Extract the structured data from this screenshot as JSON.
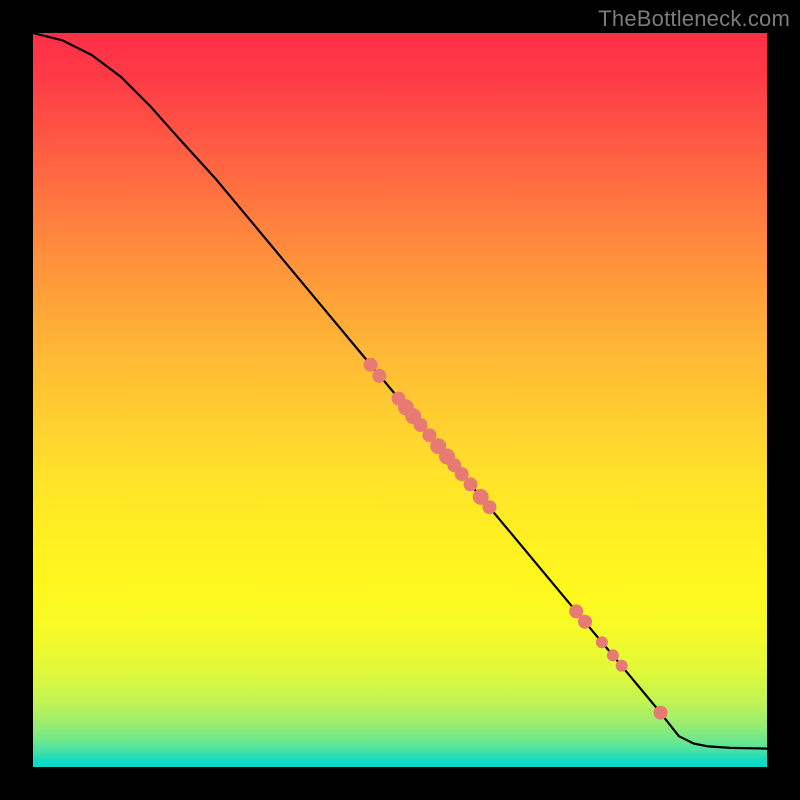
{
  "watermark": "TheBottleneck.com",
  "colors": {
    "point_fill": "#e77a72",
    "curve_stroke": "#000000",
    "gradient_top": "#ff2e47",
    "gradient_mid": "#fff120",
    "gradient_bottom": "#06d8cc",
    "frame": "#000000"
  },
  "chart_data": {
    "type": "line",
    "title": "",
    "xlabel": "",
    "ylabel": "",
    "xlim": [
      0,
      100
    ],
    "ylim": [
      0,
      100
    ],
    "curve": [
      {
        "x": 0,
        "y": 100
      },
      {
        "x": 4,
        "y": 99
      },
      {
        "x": 8,
        "y": 97
      },
      {
        "x": 12,
        "y": 94
      },
      {
        "x": 16,
        "y": 90
      },
      {
        "x": 20,
        "y": 85.5
      },
      {
        "x": 25,
        "y": 80
      },
      {
        "x": 30,
        "y": 74
      },
      {
        "x": 35,
        "y": 68
      },
      {
        "x": 40,
        "y": 62
      },
      {
        "x": 45,
        "y": 56
      },
      {
        "x": 50,
        "y": 50
      },
      {
        "x": 55,
        "y": 44
      },
      {
        "x": 60,
        "y": 38
      },
      {
        "x": 65,
        "y": 32
      },
      {
        "x": 70,
        "y": 26
      },
      {
        "x": 75,
        "y": 20
      },
      {
        "x": 80,
        "y": 14
      },
      {
        "x": 85,
        "y": 8
      },
      {
        "x": 88,
        "y": 4.2
      },
      {
        "x": 90,
        "y": 3.2
      },
      {
        "x": 92,
        "y": 2.8
      },
      {
        "x": 95,
        "y": 2.6
      },
      {
        "x": 100,
        "y": 2.5
      }
    ],
    "points": [
      {
        "x": 46.0,
        "y": 54.8,
        "r": 7
      },
      {
        "x": 47.2,
        "y": 53.3,
        "r": 7
      },
      {
        "x": 49.8,
        "y": 50.2,
        "r": 7
      },
      {
        "x": 50.8,
        "y": 49.0,
        "r": 8
      },
      {
        "x": 51.8,
        "y": 47.8,
        "r": 8
      },
      {
        "x": 52.8,
        "y": 46.6,
        "r": 7
      },
      {
        "x": 54.0,
        "y": 45.2,
        "r": 7
      },
      {
        "x": 55.2,
        "y": 43.7,
        "r": 8
      },
      {
        "x": 56.4,
        "y": 42.3,
        "r": 8
      },
      {
        "x": 57.4,
        "y": 41.1,
        "r": 7
      },
      {
        "x": 58.4,
        "y": 39.9,
        "r": 7
      },
      {
        "x": 59.6,
        "y": 38.5,
        "r": 7
      },
      {
        "x": 61.0,
        "y": 36.8,
        "r": 8
      },
      {
        "x": 62.2,
        "y": 35.4,
        "r": 7
      },
      {
        "x": 74.0,
        "y": 21.2,
        "r": 7
      },
      {
        "x": 75.2,
        "y": 19.8,
        "r": 7
      },
      {
        "x": 77.5,
        "y": 17.0,
        "r": 6
      },
      {
        "x": 79.0,
        "y": 15.2,
        "r": 6
      },
      {
        "x": 80.2,
        "y": 13.8,
        "r": 6
      },
      {
        "x": 85.5,
        "y": 7.4,
        "r": 7
      }
    ]
  }
}
